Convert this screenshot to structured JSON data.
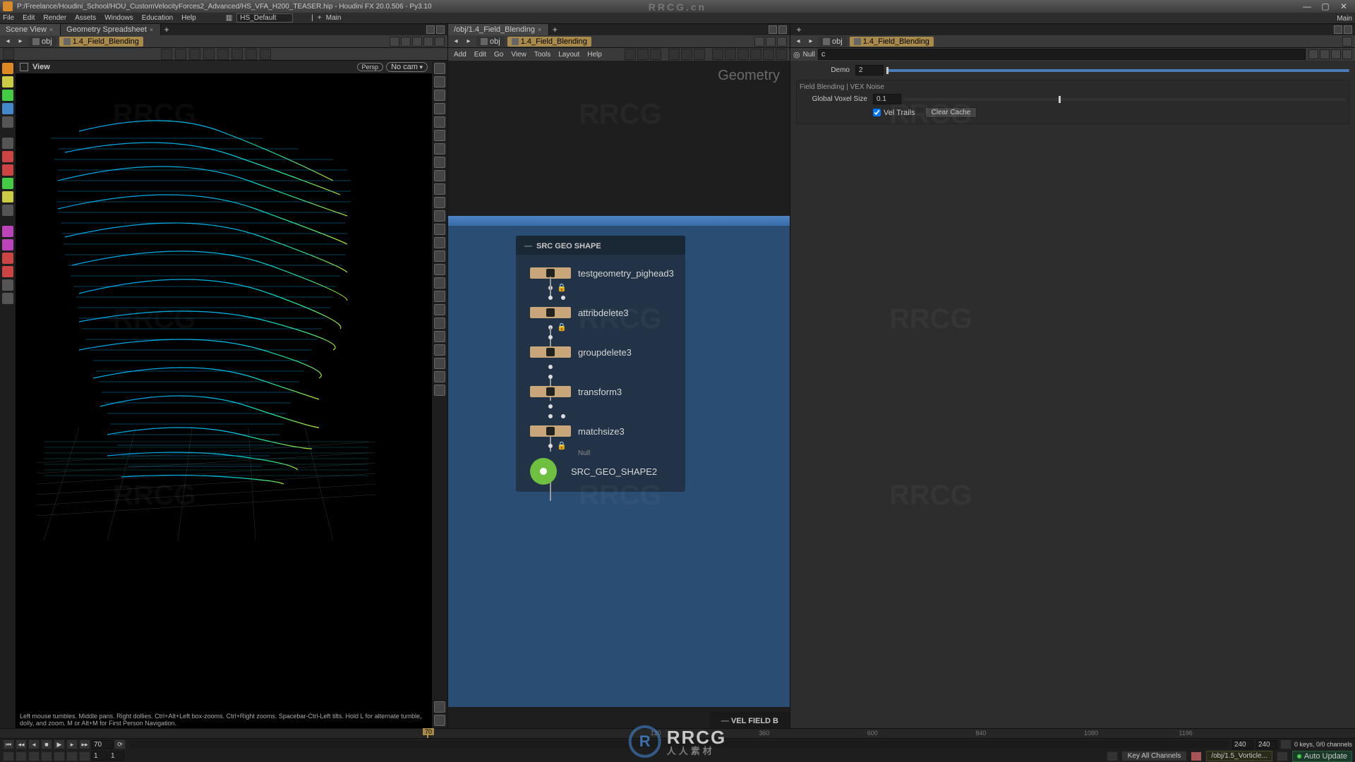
{
  "title": "P:/Freelance/Houdini_School/HOU_CustomVelocityForces2_Advanced/HS_VFA_H200_TEASER.hip - Houdini FX 20.0.506 - Py3.10",
  "menus": [
    "File",
    "Edit",
    "Render",
    "Assets",
    "Windows",
    "Education",
    "Help"
  ],
  "desktop_label": "HS_Default",
  "shelf_main": "Main",
  "left": {
    "tabs": [
      "Scene View",
      "Geometry Spreadsheet"
    ],
    "path_obj": "obj",
    "path_node": "1.4_Field_Blending",
    "view_label": "View",
    "persp": "Persp",
    "cam": "No cam",
    "footer": "Left mouse tumbles. Middle pans. Right dollies. Ctrl+Alt+Left box-zooms. Ctrl+Right zooms. Spacebar-Ctrl-Left tilts. Hold L for alternate tumble, dolly, and zoom. M or Alt+M for First Person Navigation."
  },
  "mid": {
    "tab": "/obj/1.4_Field_Blending",
    "path_obj": "obj",
    "path_node": "1.4_Field_Blending",
    "menu": [
      "Add",
      "Edit",
      "Go",
      "View",
      "Tools",
      "Layout",
      "Help"
    ],
    "geo_label": "Geometry",
    "panel_title": "SRC GEO SHAPE",
    "nodes": [
      {
        "name": "testgeometry_pighead3",
        "sub": ""
      },
      {
        "name": "attribdelete3",
        "sub": ""
      },
      {
        "name": "groupdelete3",
        "sub": ""
      },
      {
        "name": "transform3",
        "sub": ""
      },
      {
        "name": "matchsize3",
        "sub": ""
      },
      {
        "name": "SRC_GEO_SHAPE2",
        "sub": "Null",
        "green": true
      }
    ],
    "vel_b": "VEL FIELD B"
  },
  "right": {
    "path_obj": "obj",
    "path_node": "1.4_Field_Blending",
    "node_search_label": "Null",
    "node_search": "c",
    "demo_label": "Demo",
    "demo": "2",
    "section": "Field Blending | VEX Noise",
    "voxel_label": "Global Voxel Size",
    "voxel": "0.1",
    "trails_label": "Vel Trails",
    "clear_cache": "Clear Cache"
  },
  "timeline": {
    "cur_frame": "70",
    "keys_status": "0 keys, 0/0 channels",
    "key_all": "Key All Channels",
    "start": "1",
    "start2": "1",
    "end": "240",
    "end2": "240",
    "job": "/obj/1.5_Vorticle...",
    "auto": "Auto Update",
    "frames": [
      "120",
      "360",
      "600",
      "840",
      "1080",
      "1196"
    ]
  },
  "watermark": "RRCG",
  "watermark_top": "RRCG.cn",
  "watermark_sub": "人人素材"
}
